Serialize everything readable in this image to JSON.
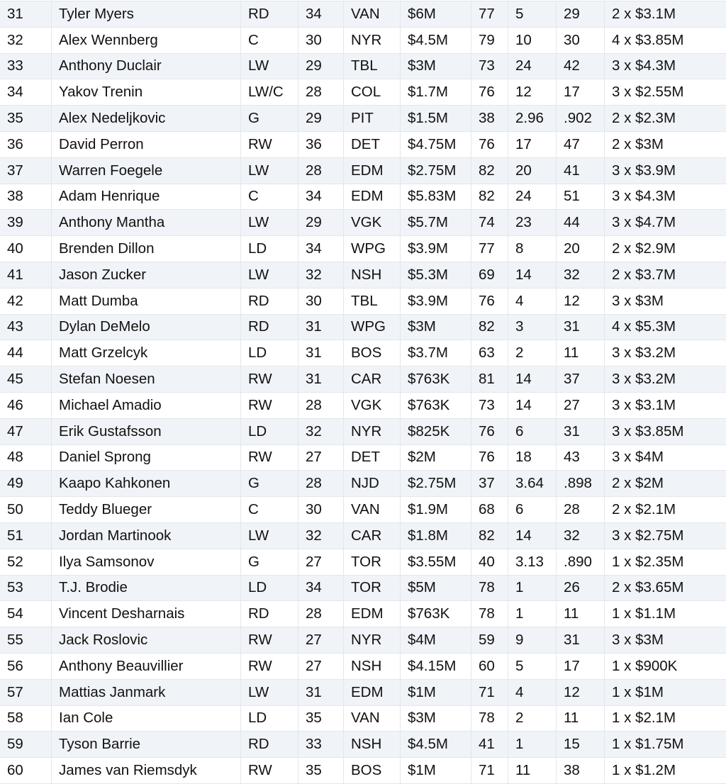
{
  "table": {
    "rows": [
      [
        "31",
        "Tyler Myers",
        "RD",
        "34",
        "VAN",
        "$6M",
        "77",
        "5",
        "29",
        "2 x $3.1M"
      ],
      [
        "32",
        "Alex Wennberg",
        "C",
        "30",
        "NYR",
        "$4.5M",
        "79",
        "10",
        "30",
        "4 x $3.85M"
      ],
      [
        "33",
        "Anthony Duclair",
        "LW",
        "29",
        "TBL",
        "$3M",
        "73",
        "24",
        "42",
        "3 x $4.3M"
      ],
      [
        "34",
        "Yakov Trenin",
        "LW/C",
        "28",
        "COL",
        "$1.7M",
        "76",
        "12",
        "17",
        "3 x $2.55M"
      ],
      [
        "35",
        "Alex Nedeljkovic",
        "G",
        "29",
        "PIT",
        "$1.5M",
        "38",
        "2.96",
        ".902",
        "2 x $2.3M"
      ],
      [
        "36",
        "David Perron",
        "RW",
        "36",
        "DET",
        "$4.75M",
        "76",
        "17",
        "47",
        "2 x $3M"
      ],
      [
        "37",
        "Warren Foegele",
        "LW",
        "28",
        "EDM",
        "$2.75M",
        "82",
        "20",
        "41",
        "3 x $3.9M"
      ],
      [
        "38",
        "Adam Henrique",
        "C",
        "34",
        "EDM",
        "$5.83M",
        "82",
        "24",
        "51",
        "3 x $4.3M"
      ],
      [
        "39",
        "Anthony Mantha",
        "LW",
        "29",
        "VGK",
        "$5.7M",
        "74",
        "23",
        "44",
        "3 x $4.7M"
      ],
      [
        "40",
        "Brenden Dillon",
        "LD",
        "34",
        "WPG",
        "$3.9M",
        "77",
        "8",
        "20",
        "2 x $2.9M"
      ],
      [
        "41",
        "Jason Zucker",
        "LW",
        "32",
        "NSH",
        "$5.3M",
        "69",
        "14",
        "32",
        "2 x $3.7M"
      ],
      [
        "42",
        "Matt Dumba",
        "RD",
        "30",
        "TBL",
        "$3.9M",
        "76",
        "4",
        "12",
        "3 x $3M"
      ],
      [
        "43",
        "Dylan DeMelo",
        "RD",
        "31",
        "WPG",
        "$3M",
        "82",
        "3",
        "31",
        "4 x $5.3M"
      ],
      [
        "44",
        "Matt Grzelcyk",
        "LD",
        "31",
        "BOS",
        "$3.7M",
        "63",
        "2",
        "11",
        "3 x $3.2M"
      ],
      [
        "45",
        "Stefan Noesen",
        "RW",
        "31",
        "CAR",
        "$763K",
        "81",
        "14",
        "37",
        "3 x $3.2M"
      ],
      [
        "46",
        "Michael Amadio",
        "RW",
        "28",
        "VGK",
        "$763K",
        "73",
        "14",
        "27",
        "3 x $3.1M"
      ],
      [
        "47",
        "Erik Gustafsson",
        "LD",
        "32",
        "NYR",
        "$825K",
        "76",
        "6",
        "31",
        "3 x $3.85M"
      ],
      [
        "48",
        "Daniel Sprong",
        "RW",
        "27",
        "DET",
        "$2M",
        "76",
        "18",
        "43",
        "3 x $4M"
      ],
      [
        "49",
        "Kaapo Kahkonen",
        "G",
        "28",
        "NJD",
        "$2.75M",
        "37",
        "3.64",
        ".898",
        "2 x $2M"
      ],
      [
        "50",
        "Teddy Blueger",
        "C",
        "30",
        "VAN",
        "$1.9M",
        "68",
        "6",
        "28",
        "2 x $2.1M"
      ],
      [
        "51",
        "Jordan Martinook",
        "LW",
        "32",
        "CAR",
        "$1.8M",
        "82",
        "14",
        "32",
        "3 x $2.75M"
      ],
      [
        "52",
        "Ilya Samsonov",
        "G",
        "27",
        "TOR",
        "$3.55M",
        "40",
        "3.13",
        ".890",
        "1 x $2.35M"
      ],
      [
        "53",
        "T.J. Brodie",
        "LD",
        "34",
        "TOR",
        "$5M",
        "78",
        "1",
        "26",
        "2 x $3.65M"
      ],
      [
        "54",
        "Vincent Desharnais",
        "RD",
        "28",
        "EDM",
        "$763K",
        "78",
        "1",
        "11",
        "1 x $1.1M"
      ],
      [
        "55",
        "Jack Roslovic",
        "RW",
        "27",
        "NYR",
        "$4M",
        "59",
        "9",
        "31",
        "3 x $3M"
      ],
      [
        "56",
        "Anthony Beauvillier",
        "RW",
        "27",
        "NSH",
        "$4.15M",
        "60",
        "5",
        "17",
        "1 x $900K"
      ],
      [
        "57",
        "Mattias Janmark",
        "LW",
        "31",
        "EDM",
        "$1M",
        "71",
        "4",
        "12",
        "1 x $1M"
      ],
      [
        "58",
        "Ian Cole",
        "LD",
        "35",
        "VAN",
        "$3M",
        "78",
        "2",
        "11",
        "1 x $2.1M"
      ],
      [
        "59",
        "Tyson Barrie",
        "RD",
        "33",
        "NSH",
        "$4.5M",
        "41",
        "1",
        "15",
        "1 x $1.75M"
      ],
      [
        "60",
        "James van Riemsdyk",
        "RW",
        "35",
        "BOS",
        "$1M",
        "71",
        "11",
        "38",
        "1 x $1.2M"
      ]
    ]
  }
}
